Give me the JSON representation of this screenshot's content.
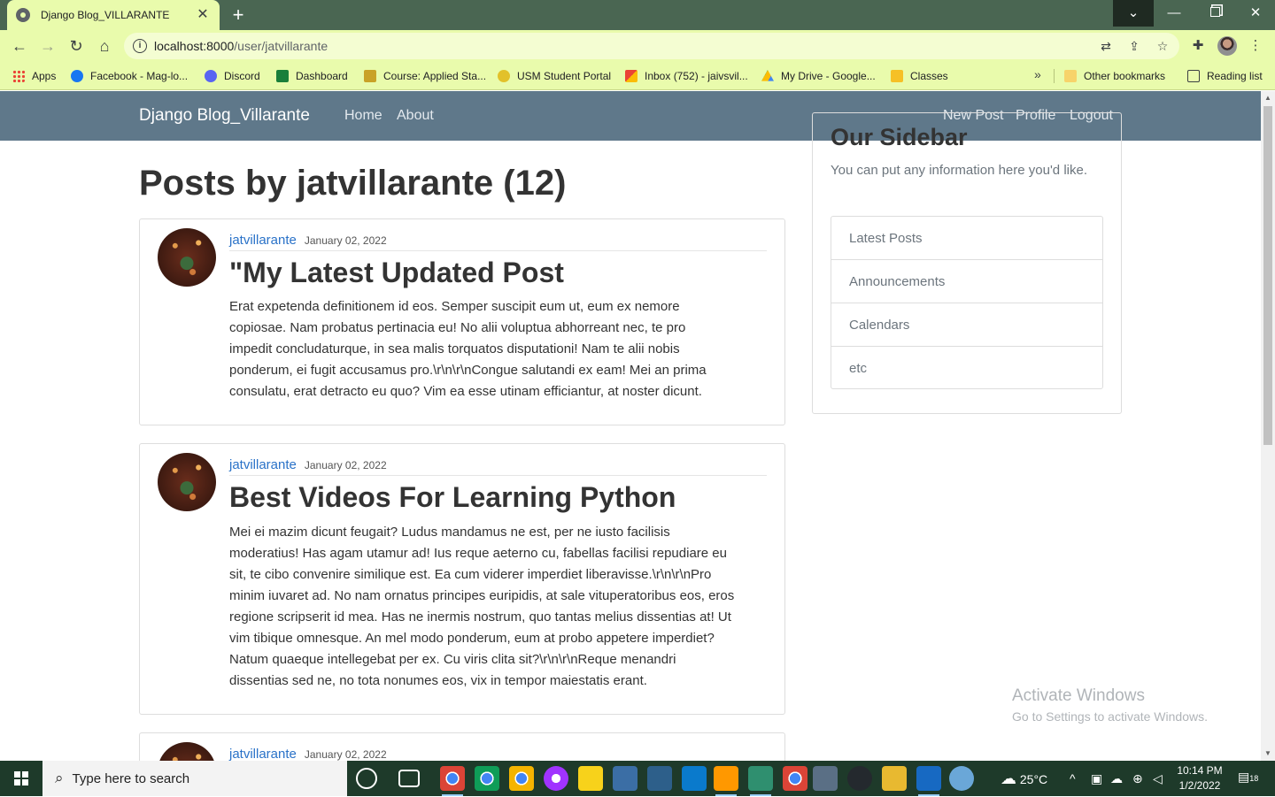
{
  "browser": {
    "tab_title": "Django Blog_VILLARANTE",
    "url_host": "localhost:8000",
    "url_path": "/user/jatvillarante",
    "bookmarks": [
      {
        "label": "Apps",
        "icon": "apps-grid-icon"
      },
      {
        "label": "Facebook - Mag-lo...",
        "icon": "facebook-icon"
      },
      {
        "label": "Discord",
        "icon": "discord-icon"
      },
      {
        "label": "Dashboard",
        "icon": "usm-dashboard-icon"
      },
      {
        "label": "Course: Applied Sta...",
        "icon": "course-icon"
      },
      {
        "label": "USM Student Portal",
        "icon": "usm-portal-icon"
      },
      {
        "label": "Inbox (752) - jaivsvil...",
        "icon": "gmail-icon"
      },
      {
        "label": "My Drive - Google...",
        "icon": "google-drive-icon"
      },
      {
        "label": "Classes",
        "icon": "google-classroom-icon"
      }
    ],
    "other_bookmarks": "Other bookmarks",
    "reading_list": "Reading list"
  },
  "site": {
    "brand": "Django Blog_Villarante",
    "nav_left": [
      "Home",
      "About"
    ],
    "nav_right": [
      "New Post",
      "Profile",
      "Logout"
    ],
    "nav_color": "#5f788a"
  },
  "page": {
    "title": "Posts by jatvillarante (12)"
  },
  "posts": [
    {
      "author": "jatvillarante",
      "date": "January 02, 2022",
      "title": "\"My Latest Updated Post",
      "body_lines": [
        "Erat expetenda definitionem id eos. Semper suscipit eum ut, eum ex nemore",
        "copiosae. Nam probatus pertinacia eu! No alii voluptua abhorreant nec, te pro",
        "impedit concludaturque, in sea malis torquatos disputationi! Nam te alii nobis",
        "ponderum, ei fugit accusamus pro.\\r\\n\\r\\nCongue salutandi ex eam! Mei an prima",
        "consulatu, erat detracto eu quo? Vim ea esse utinam efficiantur, at noster dicunt."
      ]
    },
    {
      "author": "jatvillarante",
      "date": "January 02, 2022",
      "title": "Best Videos For Learning Python",
      "body_lines": [
        "Mei ei mazim dicunt feugait? Ludus mandamus ne est, per ne iusto facilisis",
        "moderatius! Has agam utamur ad! Ius reque aeterno cu, fabellas facilisi repudiare eu",
        "sit, te cibo convenire similique est. Ea cum viderer imperdiet liberavisse.\\r\\n\\r\\nPro",
        "minim iuvaret ad. No nam ornatus principes euripidis, at sale vituperatoribus eos, eros",
        "regione scripserit id mea. Has ne inermis nostrum, quo tantas melius dissentias at! Ut",
        "vim tibique omnesque. An mel modo ponderum, eum at probo appetere imperdiet?",
        "Natum quaeque intellegebat per ex. Cu viris clita sit?\\r\\n\\r\\nReque menandri",
        "dissentias sed ne, no tota nonumes eos, vix in tempor maiestatis erant."
      ]
    },
    {
      "author": "jatvillarante",
      "date": "January 02, 2022"
    }
  ],
  "sidebar": {
    "title": "Our Sidebar",
    "text": "You can put any information here you'd like.",
    "items": [
      "Latest Posts",
      "Announcements",
      "Calendars",
      "etc"
    ]
  },
  "watermark": {
    "title": "Activate Windows",
    "subtitle": "Go to Settings to activate Windows."
  },
  "taskbar": {
    "search_placeholder": "Type here to search",
    "weather": "25°C",
    "time": "10:14 PM",
    "date": "1/2/2022",
    "notifications": "18"
  }
}
